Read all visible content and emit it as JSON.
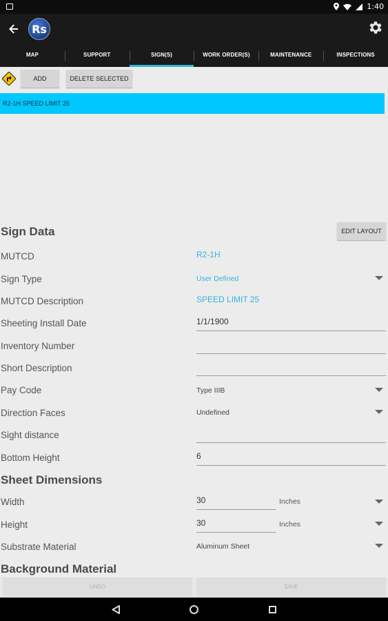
{
  "status_bar": {
    "time": "1:40"
  },
  "app": {
    "logo_text": "Rs"
  },
  "tabs": [
    {
      "label": "MAP"
    },
    {
      "label": "SUPPORT"
    },
    {
      "label": "SIGN(S)",
      "active": true
    },
    {
      "label": "WORK ORDER(S)"
    },
    {
      "label": "MAINTENANCE"
    },
    {
      "label": "INSPECTIONS"
    }
  ],
  "toolbar": {
    "add_label": "ADD",
    "delete_label": "DELETE SELECTED"
  },
  "sign_list": [
    {
      "label": "R2-1H SPEED LIMIT 25",
      "selected": true
    }
  ],
  "sign_data": {
    "title": "Sign Data",
    "edit_layout_label": "EDIT LAYOUT",
    "fields": {
      "mutcd": {
        "label": "MUTCD",
        "value": "R2-1H"
      },
      "sign_type": {
        "label": "Sign Type",
        "value": "User Defined"
      },
      "mutcd_description": {
        "label": "MUTCD Description",
        "value": "SPEED LIMIT 25"
      },
      "sheeting_install_date": {
        "label": "Sheeting Install Date",
        "value": "1/1/1900"
      },
      "inventory_number": {
        "label": "Inventory Number",
        "value": ""
      },
      "short_description": {
        "label": "Short Description",
        "value": ""
      },
      "pay_code": {
        "label": "Pay Code",
        "value": "Type IIIB"
      },
      "direction_faces": {
        "label": "Direction Faces",
        "value": "Undefined"
      },
      "sight_distance": {
        "label": "Sight distance",
        "value": ""
      },
      "bottom_height": {
        "label": "Bottom Height",
        "value": "6"
      }
    }
  },
  "sheet_dimensions": {
    "title": "Sheet Dimensions",
    "width": {
      "label": "Width",
      "value": "30",
      "unit": "Inches"
    },
    "height": {
      "label": "Height",
      "value": "30",
      "unit": "Inches"
    },
    "substrate_material": {
      "label": "Substrate Material",
      "value": "Aluminum Sheet"
    }
  },
  "background_material": {
    "title": "Background Material"
  },
  "bottom_buttons": {
    "undo_label": "UNDO",
    "save_label": "SAVE"
  },
  "colors": {
    "accent": "#2fb5d9",
    "selected_row": "#00c8ff",
    "app_bar": "#1a1a1a"
  }
}
